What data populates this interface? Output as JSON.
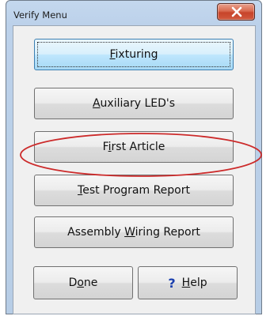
{
  "window": {
    "title": "Verify Menu"
  },
  "buttons": {
    "fixturing": {
      "pre": "",
      "key": "F",
      "post": "ixturing"
    },
    "auxiliary": {
      "pre": "",
      "key": "A",
      "post": "uxiliary LED's"
    },
    "first": {
      "pre": "F",
      "key": "i",
      "post": "rst Article"
    },
    "test": {
      "pre": "",
      "key": "T",
      "post": "est Program Report"
    },
    "assembly": {
      "pre": "Assembly ",
      "key": "W",
      "post": "iring Report"
    },
    "done": {
      "pre": "D",
      "key": "o",
      "post": "ne"
    },
    "help": {
      "icon": "?",
      "pre": "",
      "key": "H",
      "post": "elp"
    }
  },
  "icons": {
    "close": "close-icon",
    "help": "question-mark-icon"
  },
  "colors": {
    "highlight": "#cc2a2a",
    "close_button": "#c7442a"
  }
}
